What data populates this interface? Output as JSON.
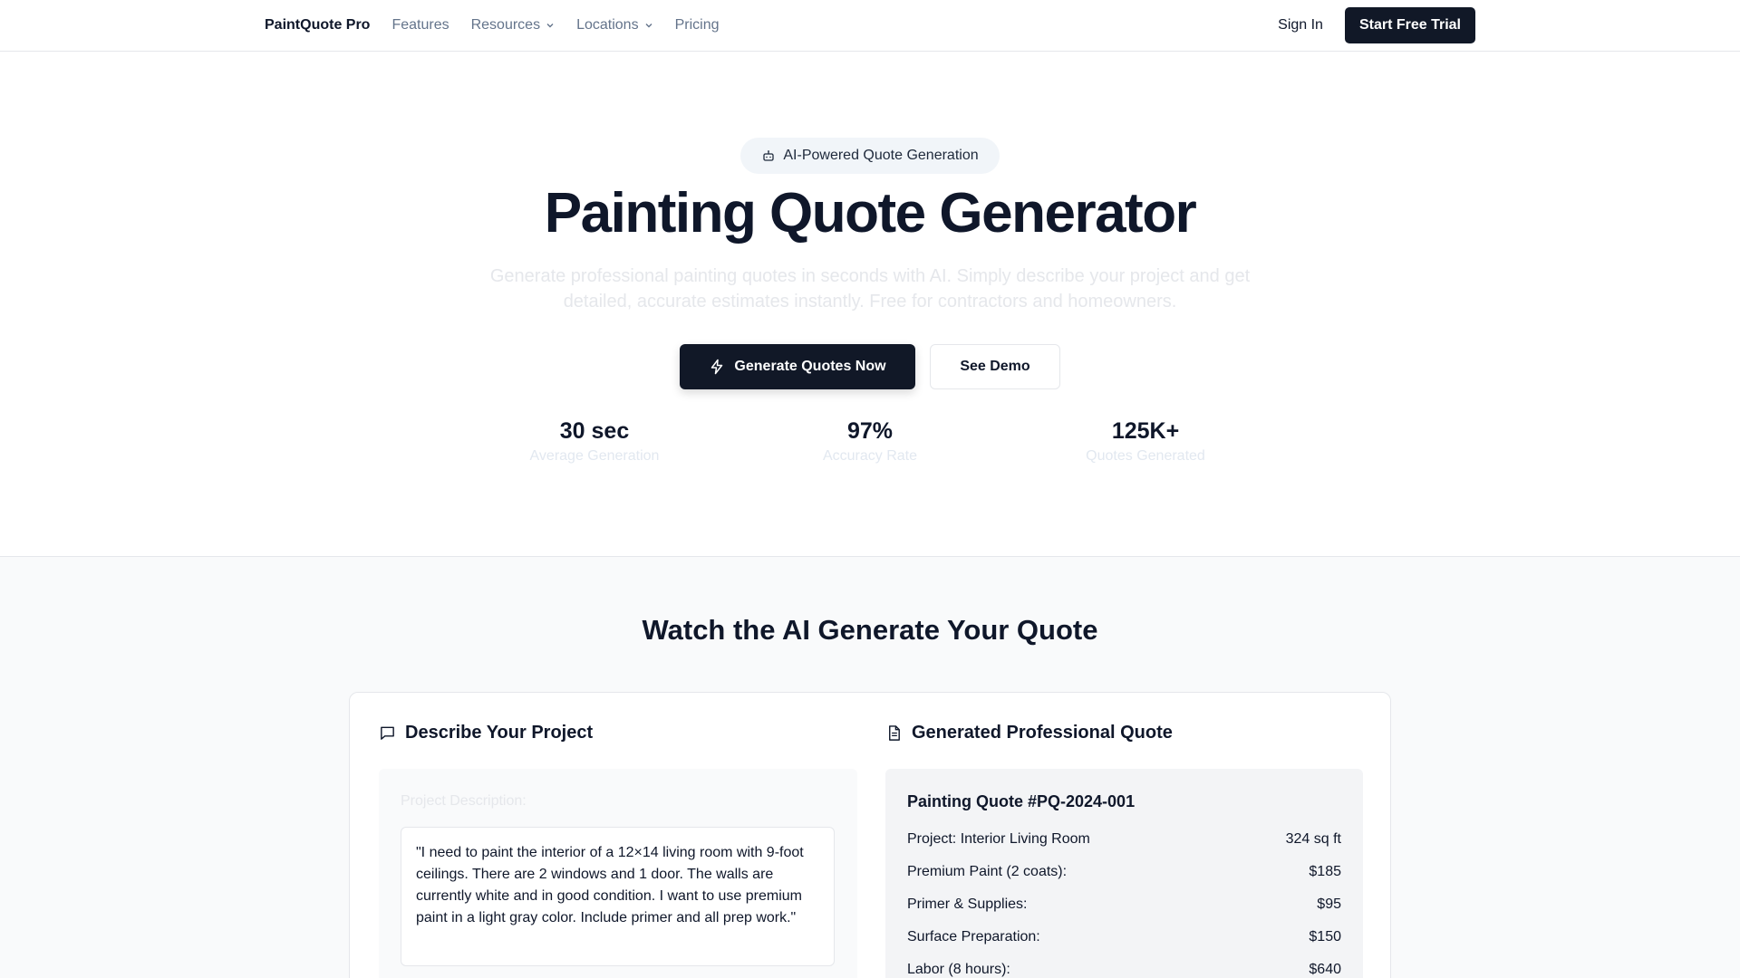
{
  "nav": {
    "brand": "PaintQuote Pro",
    "links": [
      {
        "label": "Features",
        "has_dropdown": false
      },
      {
        "label": "Resources",
        "has_dropdown": true
      },
      {
        "label": "Locations",
        "has_dropdown": true
      },
      {
        "label": "Pricing",
        "has_dropdown": false
      }
    ],
    "sign_in": "Sign In",
    "cta": "Start Free Trial"
  },
  "hero": {
    "badge": "AI-Powered Quote Generation",
    "title": "Painting Quote Generator",
    "subtitle": "Generate professional painting quotes in seconds with AI. Simply describe your project and get detailed, accurate estimates instantly. Free for contractors and homeowners.",
    "primary_button": "Generate Quotes Now",
    "secondary_button": "See Demo",
    "stats": [
      {
        "value": "30 sec",
        "label": "Average Generation"
      },
      {
        "value": "97%",
        "label": "Accuracy Rate"
      },
      {
        "value": "125K+",
        "label": "Quotes Generated"
      }
    ]
  },
  "demo": {
    "title": "Watch the AI Generate Your Quote",
    "left": {
      "heading": "Describe Your Project",
      "field_label": "Project Description:",
      "description": "\"I need to paint the interior of a 12×14 living room with 9-foot ceilings. There are 2 windows and 1 door. The walls are currently white and in good condition. I want to use premium paint in a light gray color. Include primer and all prep work.\""
    },
    "right": {
      "heading": "Generated Professional Quote",
      "quote_title": "Painting Quote #PQ-2024-001",
      "lines": [
        {
          "label": "Project: Interior Living Room",
          "value": "324 sq ft"
        },
        {
          "label": "Premium Paint (2 coats):",
          "value": "$185"
        },
        {
          "label": "Primer & Supplies:",
          "value": "$95"
        },
        {
          "label": "Surface Preparation:",
          "value": "$150"
        },
        {
          "label": "Labor (8 hours):",
          "value": "$640"
        }
      ]
    }
  },
  "colors": {
    "primary": "#111827",
    "muted_text": "#64748b",
    "section_bg": "#f9fafb"
  }
}
